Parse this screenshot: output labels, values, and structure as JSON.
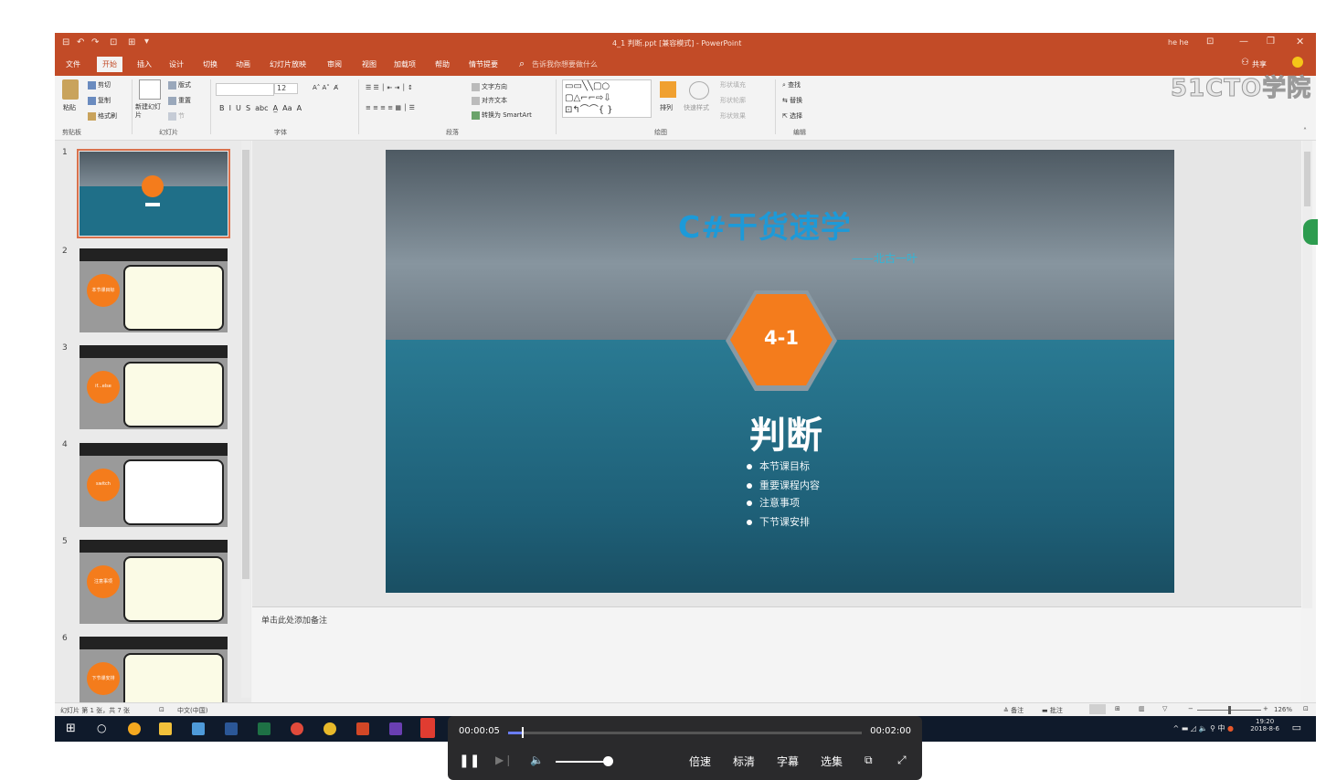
{
  "window": {
    "title": "4_1 判断.ppt [兼容模式] - PowerPoint",
    "user": "he he"
  },
  "tabs": [
    "文件",
    "开始",
    "插入",
    "设计",
    "切换",
    "动画",
    "幻灯片放映",
    "审阅",
    "视图",
    "加载项",
    "帮助",
    "情节提要"
  ],
  "active_tab": "开始",
  "tell_me": "告诉我你想要做什么",
  "share": "共享",
  "ribbon": {
    "clipboard": {
      "paste": "粘贴",
      "cut": "剪切",
      "copy": "复制",
      "format_painter": "格式刷",
      "group": "剪贴板"
    },
    "slides": {
      "new_slide": "新建幻灯片",
      "layout": "版式",
      "reset": "重置",
      "section": "节",
      "group": "幻灯片"
    },
    "font": {
      "size": "12",
      "group": "字体"
    },
    "paragraph": {
      "text_direction": "文字方向",
      "align_text": "对齐文本",
      "smartart": "转换为 SmartArt",
      "group": "段落"
    },
    "drawing": {
      "arrange": "排列",
      "quick_styles": "快速样式",
      "fill": "形状填充",
      "outline": "形状轮廓",
      "effects": "形状效果",
      "group": "绘图"
    },
    "editing": {
      "find": "查找",
      "replace": "替换",
      "select": "选择",
      "group": "编辑"
    }
  },
  "watermark": "51CTO学院",
  "slide_numbers": [
    "1",
    "2",
    "3",
    "4",
    "5",
    "6"
  ],
  "thumb_labels": [
    "",
    "本节课目标",
    "if...else",
    "switch",
    "注意事项",
    "下节课安排"
  ],
  "slide": {
    "title": "C#干货速学",
    "subtitle": "——北古一叶",
    "hex_label": "4-1",
    "heading": "判断",
    "bullets": [
      "本节课目标",
      "重要课程内容",
      "注意事项",
      "下节课安排"
    ]
  },
  "notes_placeholder": "单击此处添加备注",
  "status": {
    "slide_info": "幻灯片 第 1 张，共 7 张",
    "language": "中文(中国)",
    "notes": "备注",
    "comments": "批注",
    "zoom": "126%"
  },
  "taskbar": {
    "time": "19:20",
    "date": "2018-8-6",
    "ime": "中"
  },
  "player": {
    "current_time": "00:00:05",
    "total_time": "00:02:00",
    "progress": 0.04,
    "volume": 1.0,
    "speed": "倍速",
    "quality": "标清",
    "subtitles": "字幕",
    "episodes": "选集"
  },
  "colors": {
    "ppt_accent": "#c24b27",
    "slide_title": "#1d9ad8",
    "hexagon": "#f47c1c",
    "slide_bg": "#1f6f88",
    "taskbar": "#0f1a2b",
    "player_bg": "#2a2a2c"
  }
}
